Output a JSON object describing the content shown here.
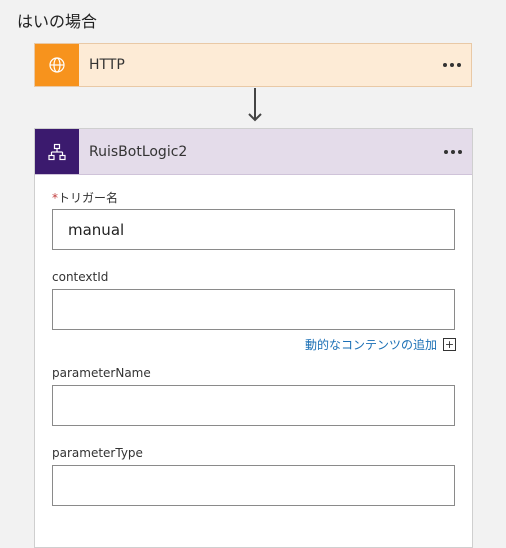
{
  "branch": {
    "title": "はいの場合"
  },
  "http_card": {
    "title": "HTTP",
    "icon": "globe-icon",
    "color": "#f7931d"
  },
  "logic_card": {
    "title": "RuisBotLogic2",
    "icon": "hierarchy-icon",
    "color": "#3b1a6e",
    "fields": [
      {
        "label": "トリガー名",
        "required": "*",
        "value": "manual"
      },
      {
        "label": "contextId",
        "value": ""
      },
      {
        "label": "parameterName",
        "value": ""
      },
      {
        "label": "parameterType",
        "value": ""
      }
    ],
    "dynamic_content_link": "動的なコンテンツの追加",
    "dynamic_content_icon": "+"
  }
}
